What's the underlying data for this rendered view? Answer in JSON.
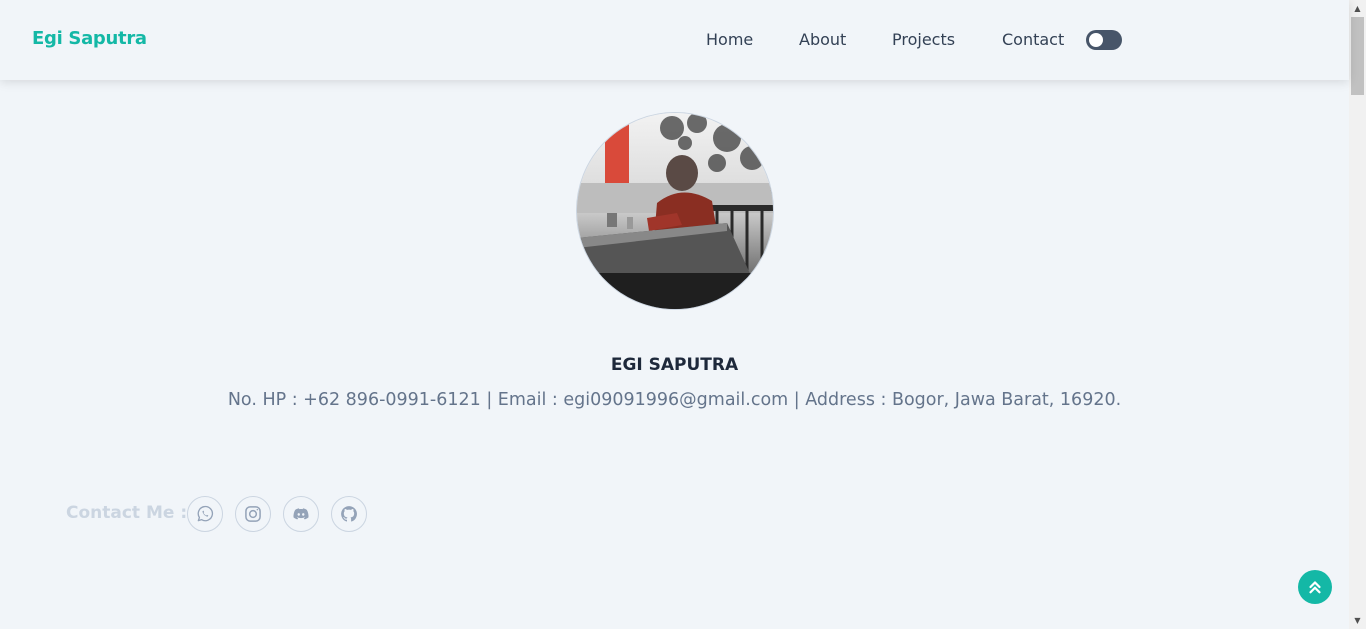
{
  "navbar": {
    "brand": "Egi Saputra",
    "items": [
      {
        "label": "Home"
      },
      {
        "label": "About"
      },
      {
        "label": "Projects"
      },
      {
        "label": "Contact"
      }
    ],
    "theme_toggle": {
      "state": "off",
      "icon": "toggle-switch-icon"
    }
  },
  "profile": {
    "photo_icon": "profile-photo",
    "name": "EGI SAPUTRA",
    "contact_line": "No. HP : +62 896-0991-6121 | Email : egi09091996@gmail.com | Address : Bogor, Jawa Barat, 16920."
  },
  "contact": {
    "label": "Contact Me :",
    "socials": [
      {
        "icon": "whatsapp-icon"
      },
      {
        "icon": "instagram-icon"
      },
      {
        "icon": "discord-icon"
      },
      {
        "icon": "github-icon"
      }
    ]
  },
  "back_to_top": {
    "icon": "chevron-double-up-icon"
  },
  "colors": {
    "accent": "#14b8a6",
    "background": "#f1f5f9",
    "text_primary": "#1e293b",
    "text_secondary": "#64748b",
    "muted": "#cbd5e1",
    "toggle": "#475569"
  }
}
